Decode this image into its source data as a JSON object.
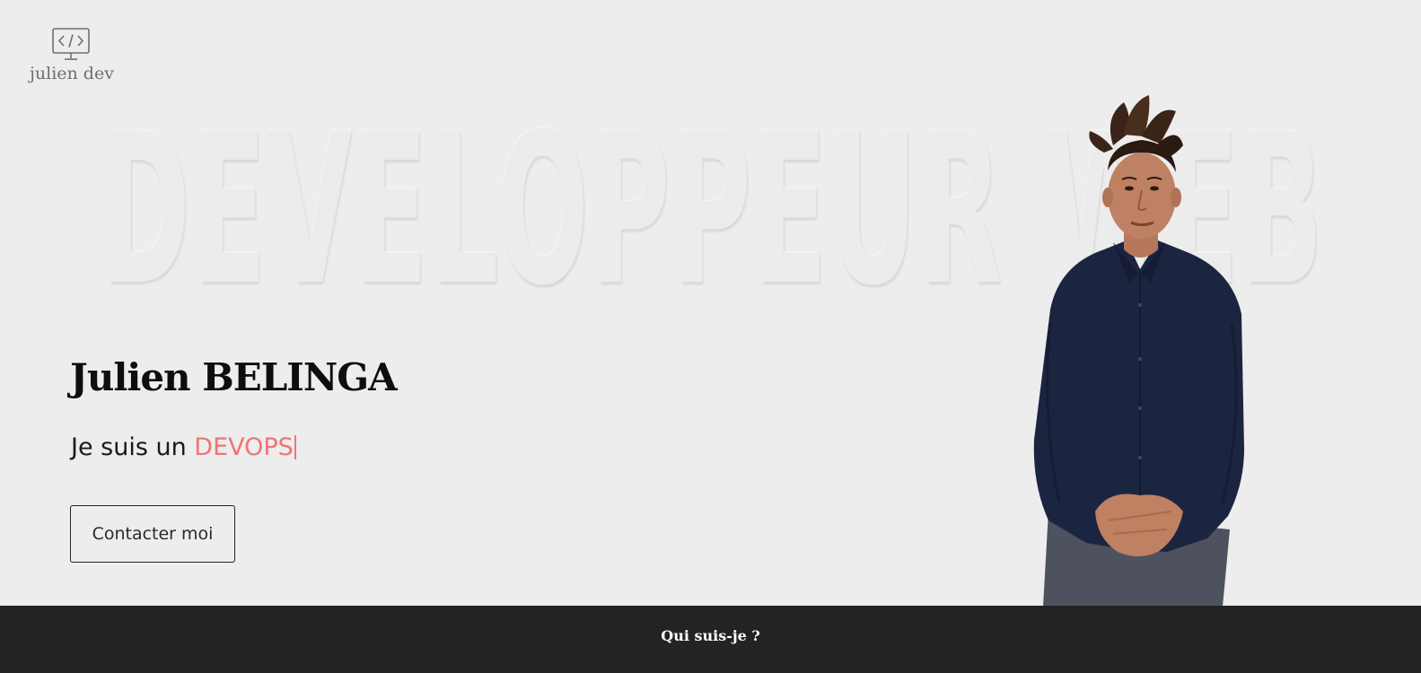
{
  "logo": {
    "icon": "code-monitor-icon",
    "text": "julien dev"
  },
  "hero": {
    "background_text": "DEVELOPPEUR WEB",
    "name": "Julien BELINGA",
    "tagline_prefix": "Je suis un ",
    "tagline_role": "DEVOPS",
    "role_color": "#f07474",
    "contact_button": "Contacter moi"
  },
  "portrait": {
    "description_icon": "person-portrait-icon"
  },
  "footer": {
    "link_label": "Qui suis-je ?",
    "background": "#232325"
  }
}
